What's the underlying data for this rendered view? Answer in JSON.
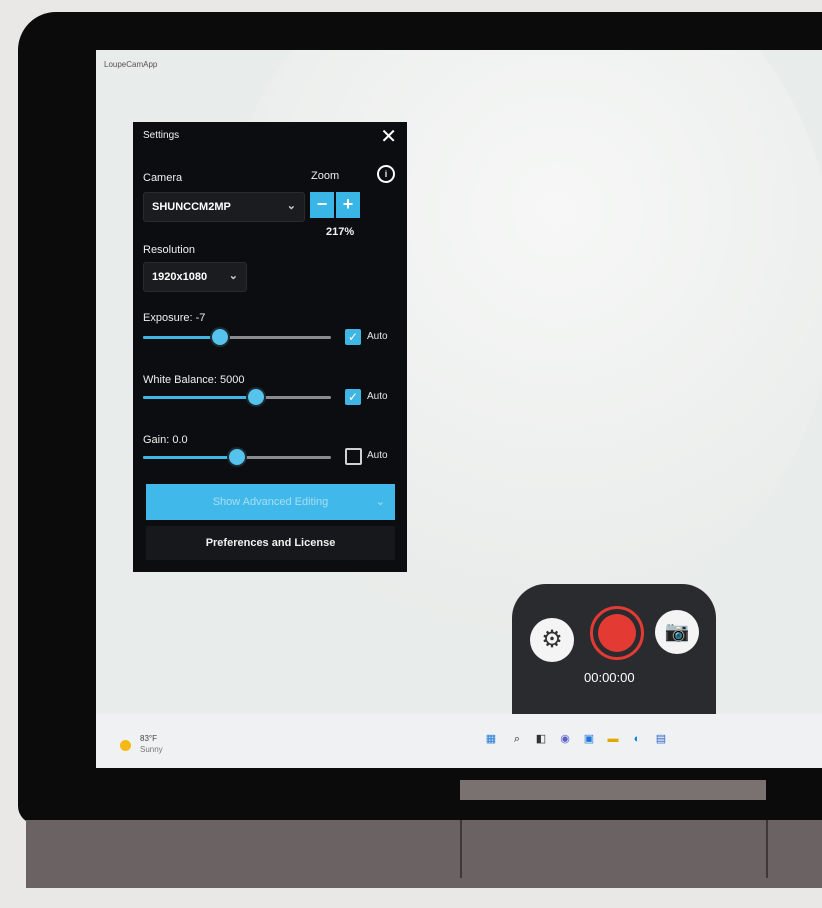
{
  "app": {
    "title": "LoupeCamApp"
  },
  "settings": {
    "title": "Settings",
    "camera": {
      "label": "Camera",
      "selected": "SHUNCCM2MP"
    },
    "zoom": {
      "label": "Zoom",
      "minus": "−",
      "plus": "+",
      "value": "217%"
    },
    "resolution": {
      "label": "Resolution",
      "selected": "1920x1080"
    },
    "exposure": {
      "label": "Exposure:",
      "value": "-7",
      "slider_fraction": 0.41,
      "auto": true,
      "auto_label": "Auto"
    },
    "white_balance": {
      "label": "White Balance:",
      "value": "5000",
      "slider_fraction": 0.6,
      "auto": true,
      "auto_label": "Auto"
    },
    "gain": {
      "label": "Gain:",
      "value": "0.0",
      "slider_fraction": 0.5,
      "auto": false,
      "auto_label": "Auto"
    },
    "advanced_button": "Show Advanced Editing",
    "preferences_button": "Preferences and License"
  },
  "controls": {
    "timer": "00:00:00"
  },
  "taskbar": {
    "weather_temp": "83°F",
    "weather_cond": "Sunny"
  },
  "colors": {
    "accent": "#3fb6e3",
    "record": "#e33b34",
    "panel_bg": "#0c0d10"
  }
}
